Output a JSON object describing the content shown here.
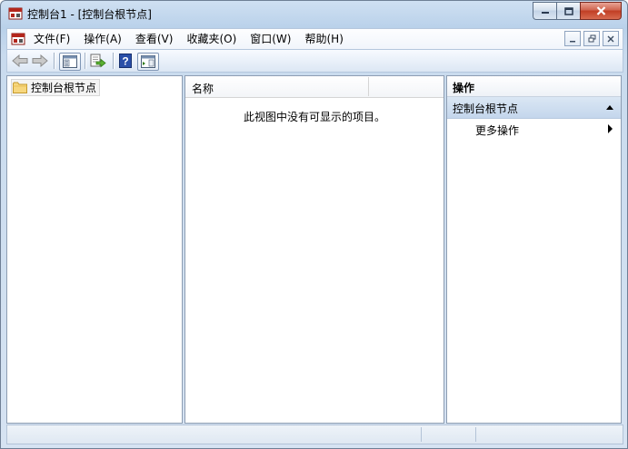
{
  "window": {
    "title": "控制台1 - [控制台根节点]",
    "controls": {
      "minimize": "—",
      "maximize": "□",
      "close": "✕"
    }
  },
  "menubar": {
    "items": [
      {
        "label": "文件(F)"
      },
      {
        "label": "操作(A)"
      },
      {
        "label": "查看(V)"
      },
      {
        "label": "收藏夹(O)"
      },
      {
        "label": "窗口(W)"
      },
      {
        "label": "帮助(H)"
      }
    ],
    "mdi_controls": {
      "minimize": "—",
      "restore": "❐",
      "close": "✕"
    }
  },
  "toolbar": {
    "buttons": [
      {
        "name": "back-button",
        "icon": "back-arrow-icon"
      },
      {
        "name": "forward-button",
        "icon": "forward-arrow-icon"
      },
      {
        "name": "show-hide-console-tree-button",
        "icon": "console-tree-icon"
      },
      {
        "name": "export-list-button",
        "icon": "export-icon"
      },
      {
        "name": "help-button",
        "icon": "help-icon",
        "glyph": "?"
      },
      {
        "name": "show-hide-action-pane-button",
        "icon": "action-pane-icon"
      }
    ]
  },
  "tree": {
    "root_label": "控制台根节点"
  },
  "list": {
    "columns": [
      {
        "label": "名称"
      }
    ],
    "empty_message": "此视图中没有可显示的项目。"
  },
  "actions": {
    "header": "操作",
    "section_label": "控制台根节点",
    "items": [
      {
        "label": "更多操作"
      }
    ]
  },
  "colors": {
    "accent": "#c4d6ec",
    "close_button": "#c13e24",
    "folder": "#f2cd6b"
  }
}
